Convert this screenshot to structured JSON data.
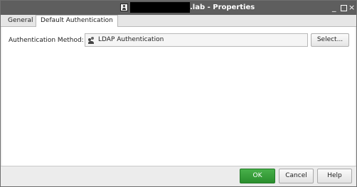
{
  "window": {
    "title": ".lab - Properties",
    "controls": {
      "minimize": "_",
      "maximize": "□",
      "close": "×"
    }
  },
  "tabs": [
    {
      "label": "General",
      "active": false
    },
    {
      "label": "Default Authentication",
      "active": true
    }
  ],
  "form": {
    "method_label": "Authentication Method:",
    "method_value": "LDAP Authentication",
    "method_icon": "users-icon",
    "select_label": "Select..."
  },
  "footer": {
    "ok_label": "OK",
    "cancel_label": "Cancel",
    "help_label": "Help"
  },
  "colors": {
    "titlebar": "#5e5e5e",
    "ok_button": "#2f9a32"
  }
}
